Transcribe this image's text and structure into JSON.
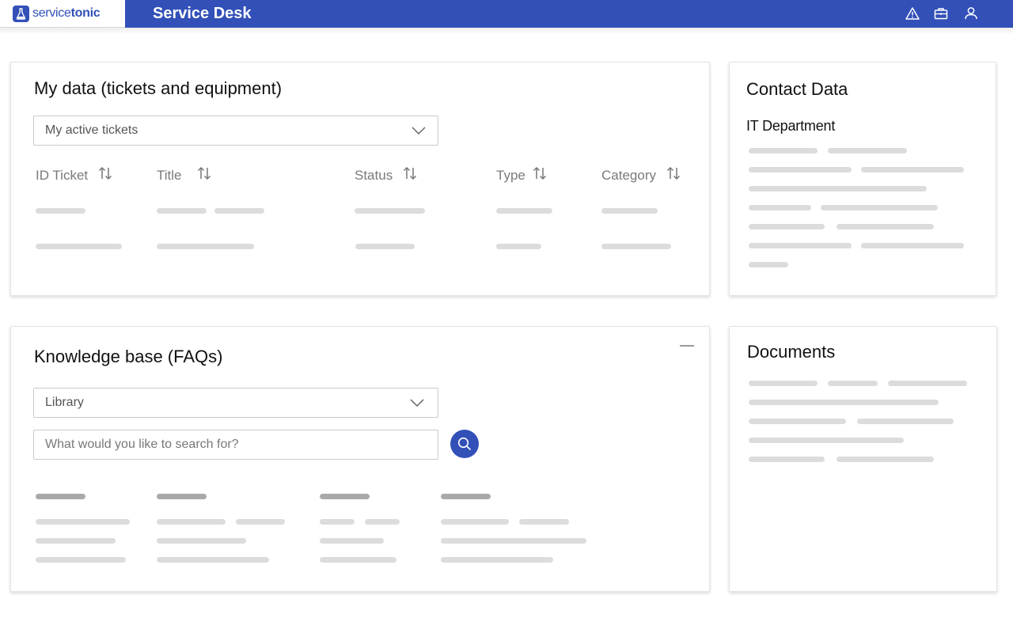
{
  "header": {
    "logo": {
      "light": "service",
      "bold": "tonic"
    },
    "title": "Service Desk",
    "icons": [
      "alert-icon",
      "briefcase-icon",
      "user-icon"
    ]
  },
  "my_data": {
    "title": "My data (tickets and equipment)",
    "filter_value": "My active tickets",
    "columns": [
      "ID Ticket",
      "Title",
      "Status",
      "Type",
      "Category"
    ]
  },
  "contact": {
    "title": "Contact Data",
    "department": "IT Department"
  },
  "knowledge": {
    "title": "Knowledge base (FAQs)",
    "library_value": "Library",
    "search_placeholder": "What would you like to search for?"
  },
  "documents": {
    "title": "Documents"
  },
  "colors": {
    "brand": "#3250b8",
    "skeleton": "#dcdcdc",
    "skeleton_dark": "#a9a9a9"
  }
}
